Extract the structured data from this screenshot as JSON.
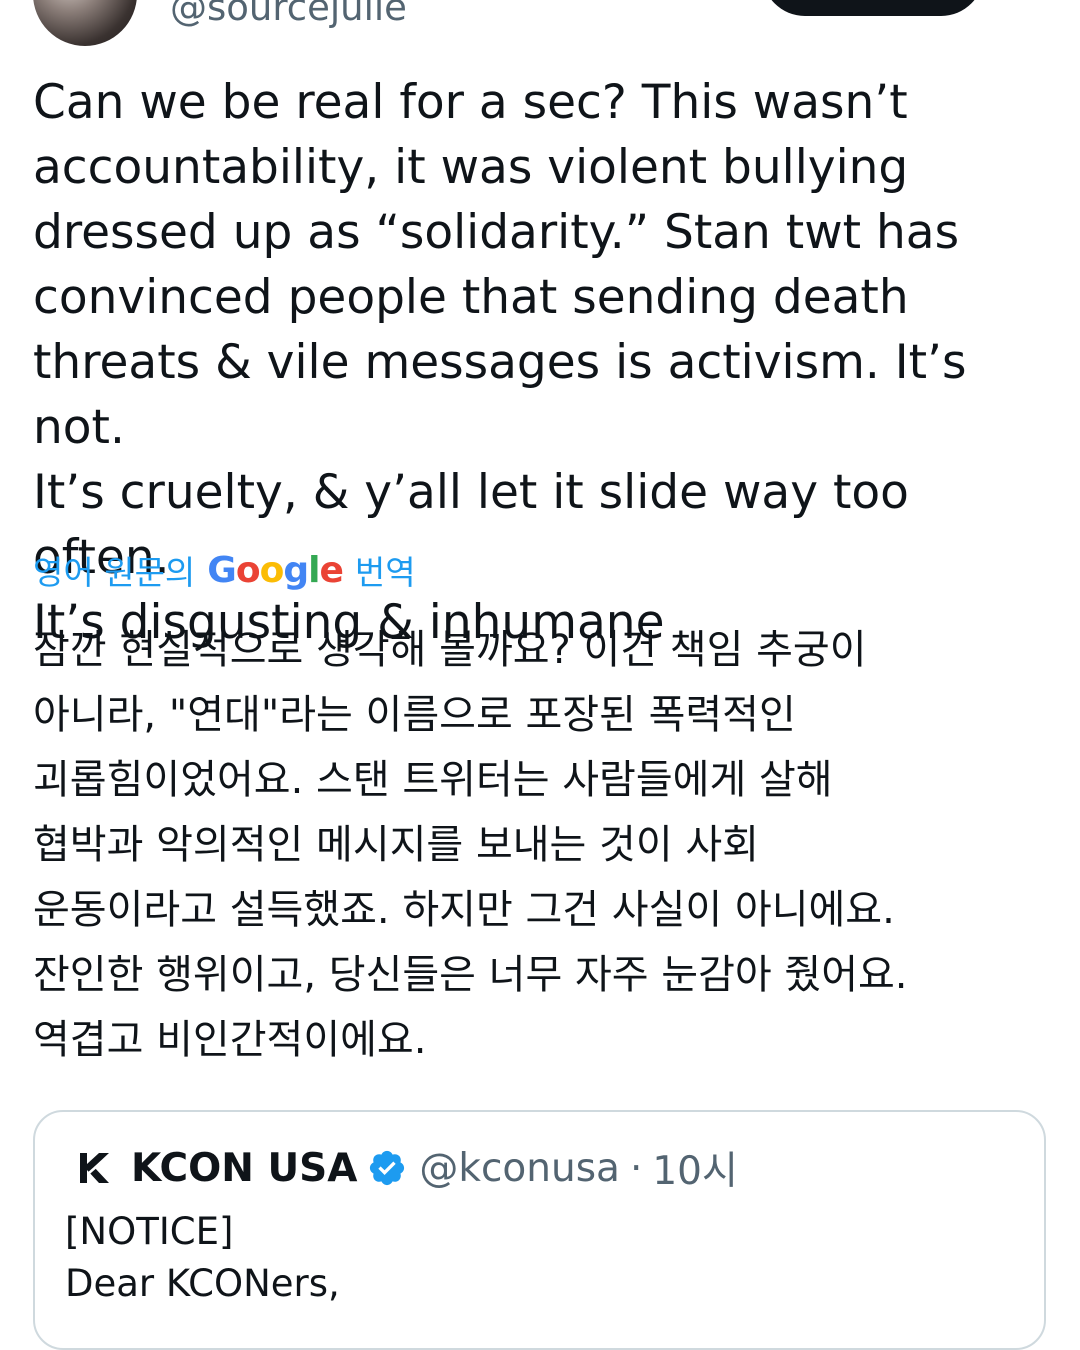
{
  "author": {
    "handle": "@sourcejulie"
  },
  "tweet": {
    "text": "Can we be real for a sec? This wasn’t\naccountability, it was violent bullying\ndressed up as “solidarity.” Stan twt has\nconvinced people that sending death\nthreats & vile messages is activism. It’s not.\nIt’s cruelty, & y’all let it slide way too often.\nIt’s disgusting & inhumane"
  },
  "translation": {
    "prefix": "영어 원문의",
    "google_letters": [
      "G",
      "o",
      "o",
      "g",
      "l",
      "e"
    ],
    "suffix": "번역",
    "text": "잠깐 현실적으로 생각해 볼까요? 이건 책임 추궁이\n아니라, \"연대\"라는 이름으로 포장된 폭력적인\n괴롭힘이었어요. 스탠 트위터는 사람들에게 살해\n협박과 악의적인 메시지를 보내는 것이 사회\n운동이라고 설득했죠. 하지만 그건 사실이 아니에요.\n잔인한 행위이고, 당신들은 너무 자주 눈감아 줬어요.\n역겹고 비인간적이에요."
  },
  "quote": {
    "name": "KCON USA",
    "handle": "@kconusa",
    "separator": "·",
    "time": "10시",
    "body": "[NOTICE]\nDear KCONers,"
  },
  "colors": {
    "link_blue": "#1d9bf0",
    "text": "#0f1419",
    "muted": "#536471",
    "border": "#cfd9de",
    "verified": "#1d9bf0"
  },
  "icons": {
    "verified": "verified-badge-icon",
    "kcon_logo": "kcon-logo-icon"
  }
}
